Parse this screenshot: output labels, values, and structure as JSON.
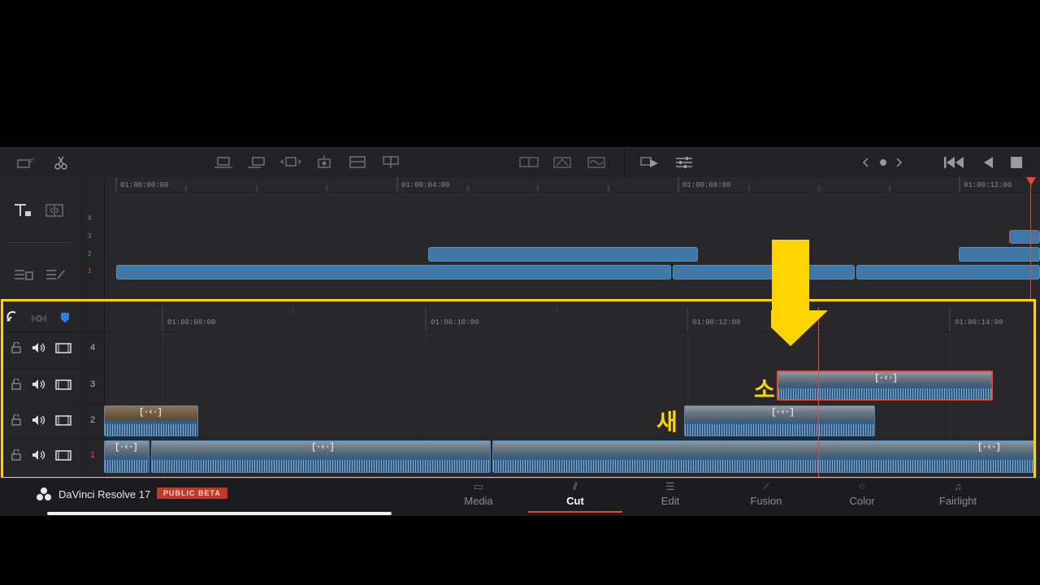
{
  "toolbar": {
    "icons": [
      "snooze-icon",
      "scissors-icon",
      "smart-insert-icon",
      "append-icon",
      "ripple-overwrite-icon",
      "close-up-icon",
      "place-on-top-icon",
      "source-overwrite-icon",
      "split-clip-icon",
      "dissolve-icon",
      "smooth-cut-icon",
      "transition-icon",
      "audio-sync-icon",
      "playhead-play-icon",
      "settings-sliders-icon",
      "prev-icon",
      "dot-icon",
      "next-icon",
      "go-to-start-icon",
      "play-reverse-icon",
      "stop-icon"
    ]
  },
  "upper_timeline": {
    "ruler_labels": [
      "01:00:00:00",
      "01:00:04:00",
      "01:00:08:00",
      "01:00:12:00"
    ],
    "track_numbers": [
      "4",
      "3",
      "2",
      "1"
    ]
  },
  "lower_timeline": {
    "ruler_labels": [
      "01:00:08:00",
      "01:00:10:00",
      "01:00:12:00",
      "01:00:14:00"
    ],
    "tracks": [
      {
        "number": "4"
      },
      {
        "number": "3"
      },
      {
        "number": "2"
      },
      {
        "number": "1"
      }
    ],
    "clip_icon": "[·‹·]"
  },
  "annotations": {
    "label_so": "소",
    "label_sae": "새"
  },
  "bottom_bar": {
    "app_name": "DaVinci Resolve 17",
    "badge": "PUBLIC BETA",
    "tabs": [
      {
        "label": "Media",
        "icon": "media-icon"
      },
      {
        "label": "Cut",
        "icon": "cut-icon",
        "active": true
      },
      {
        "label": "Edit",
        "icon": "edit-icon"
      },
      {
        "label": "Fusion",
        "icon": "fusion-icon"
      },
      {
        "label": "Color",
        "icon": "color-icon"
      },
      {
        "label": "Fairlight",
        "icon": "fairlight-icon"
      }
    ]
  },
  "colors": {
    "highlight": "#ffd400",
    "clip_blue": "#3f78a8",
    "playhead": "#e24a3b",
    "selected_clip_border": "#e24a3b"
  }
}
